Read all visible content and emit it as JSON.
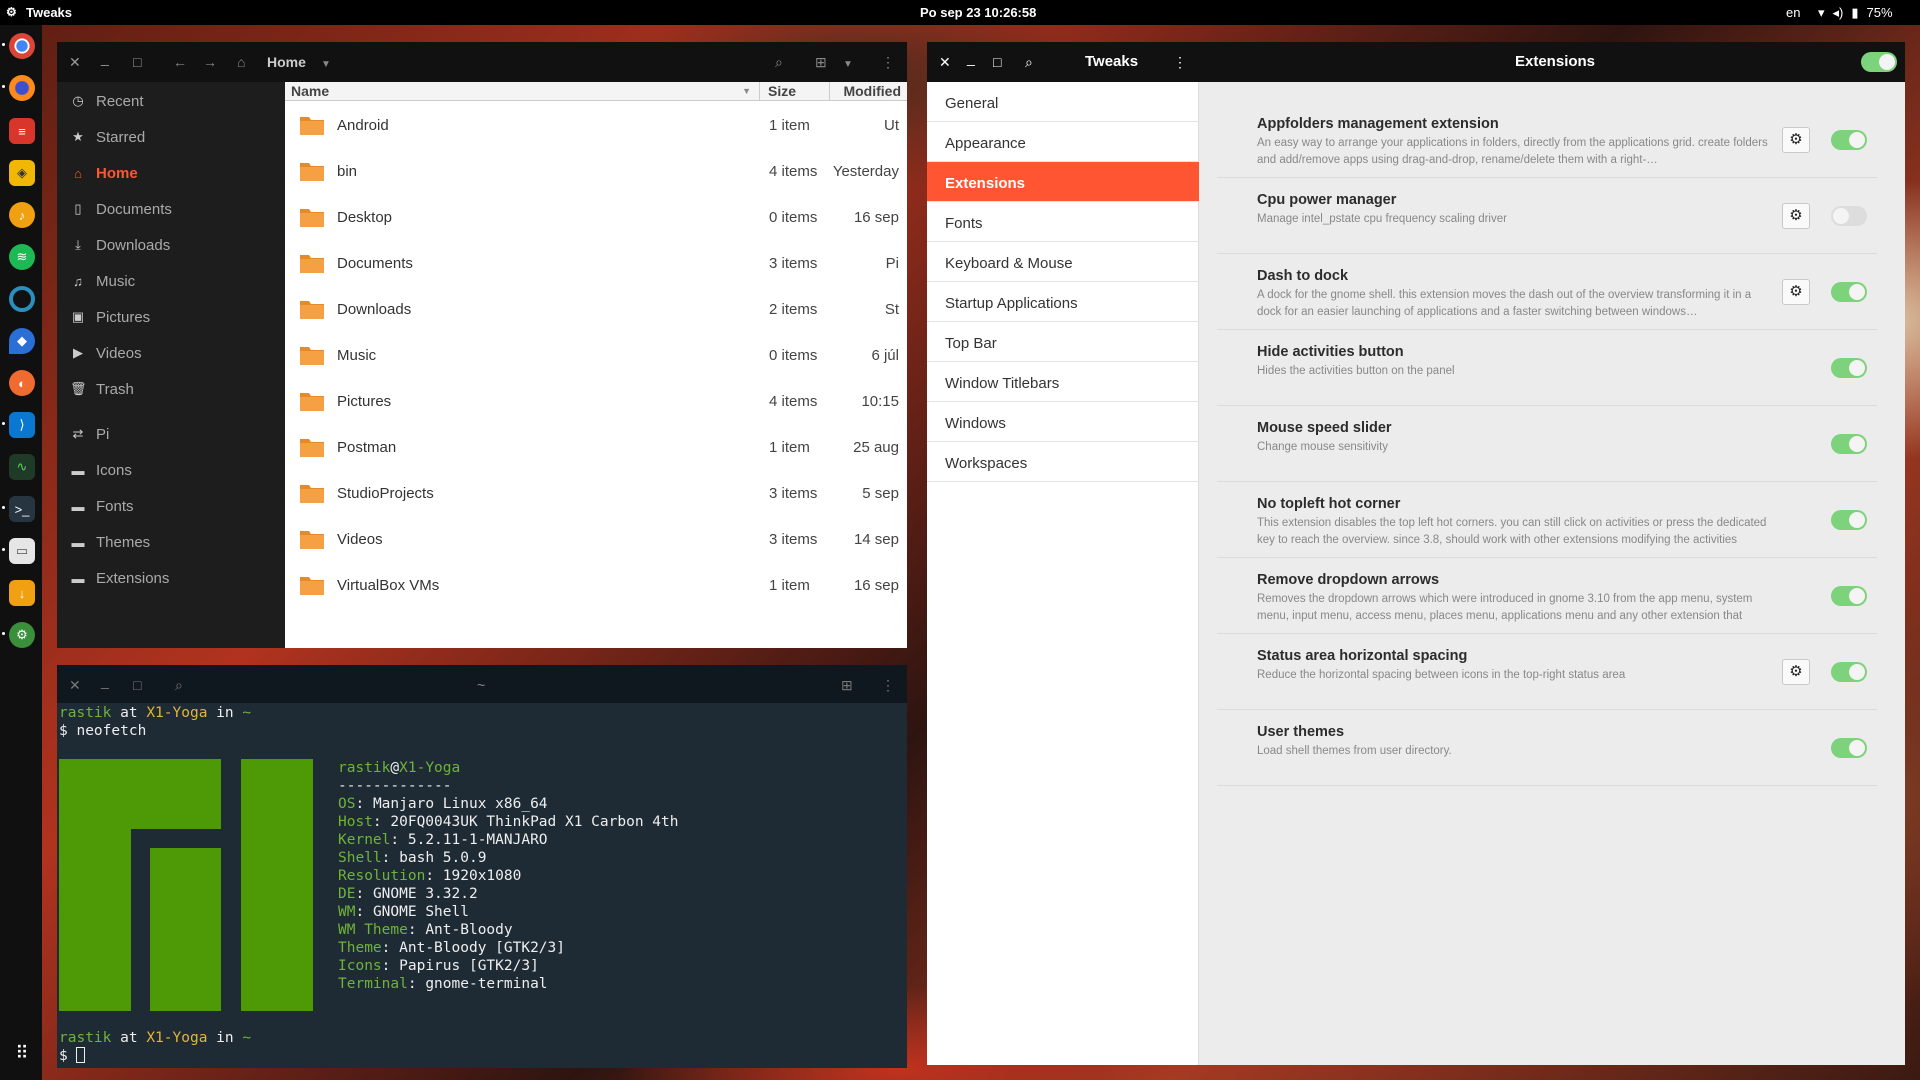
{
  "topbar": {
    "app_name": "Tweaks",
    "clock": "Po sep 23  10:26:58",
    "lang": "en",
    "battery": "75%"
  },
  "dock": {
    "icons": [
      "chrome-icon",
      "firefox-icon",
      "todo-icon",
      "lightbulb-icon",
      "music-player-icon",
      "spotify-icon",
      "browser-icon",
      "drop-icon",
      "orange-app-icon",
      "vscode-icon",
      "system-monitor-icon",
      "terminal-icon",
      "files-icon",
      "download-icon",
      "tweaks-icon",
      "app-grid-icon"
    ]
  },
  "files": {
    "path": "Home",
    "sidebar": [
      {
        "label": "Recent",
        "icon": "clock-icon"
      },
      {
        "label": "Starred",
        "icon": "star-icon"
      },
      {
        "label": "Home",
        "icon": "home-icon"
      },
      {
        "label": "Documents",
        "icon": "document-icon"
      },
      {
        "label": "Downloads",
        "icon": "download-icon"
      },
      {
        "label": "Music",
        "icon": "music-icon"
      },
      {
        "label": "Pictures",
        "icon": "picture-icon"
      },
      {
        "label": "Videos",
        "icon": "video-icon"
      },
      {
        "label": "Trash",
        "icon": "trash-icon"
      },
      {
        "label": "Pi",
        "icon": "network-icon"
      },
      {
        "label": "Icons",
        "icon": "folder-icon"
      },
      {
        "label": "Fonts",
        "icon": "folder-icon"
      },
      {
        "label": "Themes",
        "icon": "folder-icon"
      },
      {
        "label": "Extensions",
        "icon": "folder-icon"
      }
    ],
    "columns": {
      "name": "Name",
      "size": "Size",
      "modified": "Modified"
    },
    "rows": [
      {
        "name": "Android",
        "size": "1 item",
        "modified": "Ut"
      },
      {
        "name": "bin",
        "size": "4 items",
        "modified": "Yesterday"
      },
      {
        "name": "Desktop",
        "size": "0 items",
        "modified": "16 sep"
      },
      {
        "name": "Documents",
        "size": "3 items",
        "modified": "Pi"
      },
      {
        "name": "Downloads",
        "size": "2 items",
        "modified": "St"
      },
      {
        "name": "Music",
        "size": "0 items",
        "modified": "6 júl"
      },
      {
        "name": "Pictures",
        "size": "4 items",
        "modified": "10:15"
      },
      {
        "name": "Postman",
        "size": "1 item",
        "modified": "25 aug"
      },
      {
        "name": "StudioProjects",
        "size": "3 items",
        "modified": "5 sep"
      },
      {
        "name": "Videos",
        "size": "3 items",
        "modified": "14 sep"
      },
      {
        "name": "VirtualBox VMs",
        "size": "1 item",
        "modified": "16 sep"
      }
    ],
    "folder_color": "#f39c3c"
  },
  "terminal": {
    "title": "~",
    "prompt_user": "rastik",
    "prompt_at": " at ",
    "prompt_host": "X1-Yoga",
    "prompt_in": " in ",
    "prompt_dir": "~",
    "command": "$ neofetch",
    "userhost_user": "rastik",
    "userhost_at": "@",
    "userhost_host": "X1-Yoga",
    "separator": "-------------",
    "info": [
      {
        "k": "OS",
        "v": "Manjaro Linux x86_64"
      },
      {
        "k": "Host",
        "v": "20FQ0043UK ThinkPad X1 Carbon 4th"
      },
      {
        "k": "Kernel",
        "v": "5.2.11-1-MANJARO"
      },
      {
        "k": "Shell",
        "v": "bash 5.0.9"
      },
      {
        "k": "Resolution",
        "v": "1920x1080"
      },
      {
        "k": "DE",
        "v": "GNOME 3.32.2"
      },
      {
        "k": "WM",
        "v": "GNOME Shell"
      },
      {
        "k": "WM Theme",
        "v": "Ant-Bloody"
      },
      {
        "k": "Theme",
        "v": "Ant-Bloody [GTK2/3]"
      },
      {
        "k": "Icons",
        "v": "Papirus [GTK2/3]"
      },
      {
        "k": "Terminal",
        "v": "gnome-terminal"
      }
    ],
    "prompt2": "$ ",
    "logo_color": "#4e9a06"
  },
  "tweaks": {
    "title": "Tweaks",
    "panel_title": "Extensions",
    "sections": [
      "General",
      "Appearance",
      "Extensions",
      "Fonts",
      "Keyboard & Mouse",
      "Startup Applications",
      "Top Bar",
      "Window Titlebars",
      "Windows",
      "Workspaces"
    ],
    "active_section": "Extensions",
    "extensions": [
      {
        "title": "Appfolders management extension",
        "desc": "An easy way to arrange your applications in folders, directly from the applications grid. create folders and add/remove apps using drag-and-drop, rename/delete them with a right-…",
        "settings": true,
        "enabled": true
      },
      {
        "title": "Cpu power manager",
        "desc": "Manage intel_pstate cpu frequency scaling driver",
        "settings": true,
        "enabled": false
      },
      {
        "title": "Dash to dock",
        "desc": "A dock for the gnome shell. this extension moves the dash out of the overview transforming it in a dock for an easier launching of applications and a faster switching between windows…",
        "settings": true,
        "enabled": true
      },
      {
        "title": "Hide activities button",
        "desc": "Hides the activities button on the panel",
        "settings": false,
        "enabled": true
      },
      {
        "title": "Mouse speed slider",
        "desc": "Change mouse sensitivity",
        "settings": false,
        "enabled": true
      },
      {
        "title": "No topleft hot corner",
        "desc": "This extension disables the top left hot corners. you can still click on activities or press the dedicated key to reach the overview. since 3.8, should work with other extensions modifying the activities butt…",
        "settings": false,
        "enabled": true
      },
      {
        "title": "Remove dropdown arrows",
        "desc": "Removes the dropdown arrows which were introduced in gnome 3.10 from the app menu, system menu, input menu, access menu, places menu, applications menu and any other extension that wa…",
        "settings": false,
        "enabled": true
      },
      {
        "title": "Status area horizontal spacing",
        "desc": "Reduce the horizontal spacing between icons in the top-right status area",
        "settings": true,
        "enabled": true
      },
      {
        "title": "User themes",
        "desc": "Load shell themes from user directory.",
        "settings": false,
        "enabled": true
      }
    ],
    "master_enabled": true,
    "accent": "#ff5533",
    "toggle_on": "#7cd37c"
  }
}
